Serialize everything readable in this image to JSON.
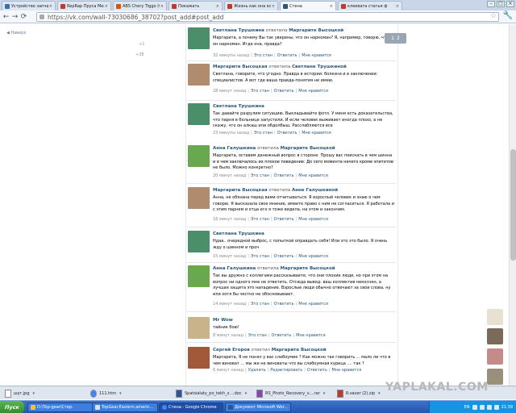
{
  "browser": {
    "tabs": [
      {
        "label": "Устройство запчасти",
        "color": "#3a6fb0"
      },
      {
        "label": "RepRap Пруса Менд",
        "color": "#c0392b"
      },
      {
        "label": "ABS Chery Tiggo (Ст",
        "color": "#d35400"
      },
      {
        "label": "Покажать",
        "color": "#c0392b"
      },
      {
        "label": "Жизнь как она есть",
        "color": "#c0392b"
      },
      {
        "label": "Стена",
        "color": "#2b587a"
      },
      {
        "label": "клеевата статья ф",
        "color": "#c0392b"
      }
    ],
    "active_tab": "Стена",
    "url": "https://vk.com/wall-73030686_38702?post_add#post_add",
    "back_icon": "back-arrow-icon",
    "forward_icon": "forward-arrow-icon",
    "reload_icon": "reload-icon"
  },
  "sidebar": {
    "back_link": "◀ Наверх",
    "counts": [
      "+1",
      "+38"
    ]
  },
  "post": {
    "counter": "1",
    "counter2": "2"
  },
  "comments": [
    {
      "author": "Светлана Трушкина",
      "reply_word": "ответила",
      "target": "Маргарите Высоцкой",
      "text": "Маргарита, а почему Вы так уверены, что он наркоман? Я, например, говорю, что он наркоман. Игде она, правда?",
      "time": "32 минуты назад",
      "actions": [
        "Это стан",
        "Ответить",
        "Мне нравится"
      ],
      "avatar_color": "#4a8f6a"
    },
    {
      "author": "Маргарита Высоцкая",
      "reply_word": "ответила",
      "target": "Светлане Трушкиной",
      "text": "Светлана, говорите, что угодно. Правда в истории: болезни и в заключении: специалистов. А вот где ваша правда-понятия не имею.",
      "time": "28 минут назад",
      "actions": [
        "Это стан",
        "Ответить",
        "Мне нравится"
      ],
      "avatar_color": "#b08b6e"
    },
    {
      "author": "Светлана Трушкина",
      "reply_word": "",
      "target": "",
      "text": "Так давайте разрулим ситуацию. Выкладывайте фото. У меня есть доказательства, что парня в больнице запустили. И если человек выживает иногда плохо, а не скажу, что он алкаш или обдолбыш. Расслабляются все",
      "time": "23 минуты назад",
      "actions": [
        "Это стан",
        "Ответить",
        "Мне нравится"
      ],
      "avatar_color": "#4a8f6a"
    },
    {
      "author": "Анна Галушкина",
      "reply_word": "ответила",
      "target": "Маргарите Высоцкой",
      "text": "Маргарита, оставим денежный вопрос в стороне. Прошу вас поискать в чем шинна и в чем заключалось их плохое поведение. До сего момента нечего кроме эпитетов не было. Можно конкретно?",
      "time": "20 минут назад",
      "actions": [
        "Это стан",
        "Ответить",
        "Мне нравится"
      ],
      "avatar_color": "#6aa84f"
    },
    {
      "author": "Маргарита Высоцкая",
      "reply_word": "ответила",
      "target": "Анне Галушкиной",
      "text": "Анна, не обязана перед вами отчитываться. Я взрослый человек и знаю о чем говорю. Я высказала свое мнение, имеете право с ним не согласиться. Я работала и с этим парнем и отца его я тоже видела, на этом и закончим.",
      "time": "16 минут назад",
      "actions": [
        "Это стан",
        "Ответить",
        "Мне нравится"
      ],
      "avatar_color": "#b08b6e"
    },
    {
      "author": "Светлана Трушкина",
      "reply_word": "",
      "target": "",
      "text": "Ндаа.. очередной выброс, с попыткой оправдать себя! Или это это было. Я очень жду о шинном и проч",
      "time": "15 минут назад",
      "actions": [
        "Это стан",
        "Ответить",
        "Мне нравится"
      ],
      "avatar_color": "#4a8f6a"
    },
    {
      "author": "Анна Галушкина",
      "reply_word": "ответила",
      "target": "Маргарите Высоцкой",
      "text": "Так вы дружно с коллегами рассказываете, что они плохие люди, но при этом на вопрос ни одного мне не ответить. Отсюда вывод: ваш коллектив некоснен, а лучшая защита это нападение. Взрослые люди обычно отвечают за свои слова, ну или хотя бы честно не обосновывают.",
      "time": "14 минут назад",
      "actions": [
        "Это стан",
        "Ответить",
        "Мне нравится"
      ],
      "avatar_color": "#6aa84f"
    },
    {
      "author": "Mr Wow",
      "reply_word": "",
      "target": "",
      "text": "тайник бою!",
      "time": "8 минут назад",
      "actions": [
        "Это стан",
        "Ответить",
        "Мне нравится"
      ],
      "avatar_color": "#c9b38a"
    },
    {
      "author": "Сергей Егоров",
      "reply_word": "ответил",
      "target": "Маргарите Высоцкой",
      "text": "Маргарита, Я не понял у вас слабоумие ? Как можно так говорить ... мало ли что в чем виноват ... мы же не виноваты что вы слабоумная курица .... так ?",
      "time": "6 минут назад",
      "actions": [
        "Удалить",
        "Редактировать",
        "Ответить",
        "Мне нравится"
      ],
      "avatar_color": "#a05a3a"
    }
  ],
  "downloads": [
    {
      "name": "шуг.jpg"
    },
    {
      "name": "111.htm"
    },
    {
      "name": "Spatsialaty_po_tekh_z....doc"
    },
    {
      "name": "RS_Photo_Recovery_v....rar"
    },
    {
      "name": "R.saver (2).zip"
    }
  ],
  "watermark": "YAPLAKAL.COM",
  "taskbar": {
    "start": "Пуск",
    "buttons": [
      {
        "label": "D:\\Top-gear\\Стер."
      },
      {
        "label": "TopGear.Eastern.americ..."
      },
      {
        "label": "Стена - Google Chrome"
      },
      {
        "label": "Документ Microsoft Wor..."
      }
    ],
    "lang": "EN",
    "clock": "21:39"
  }
}
